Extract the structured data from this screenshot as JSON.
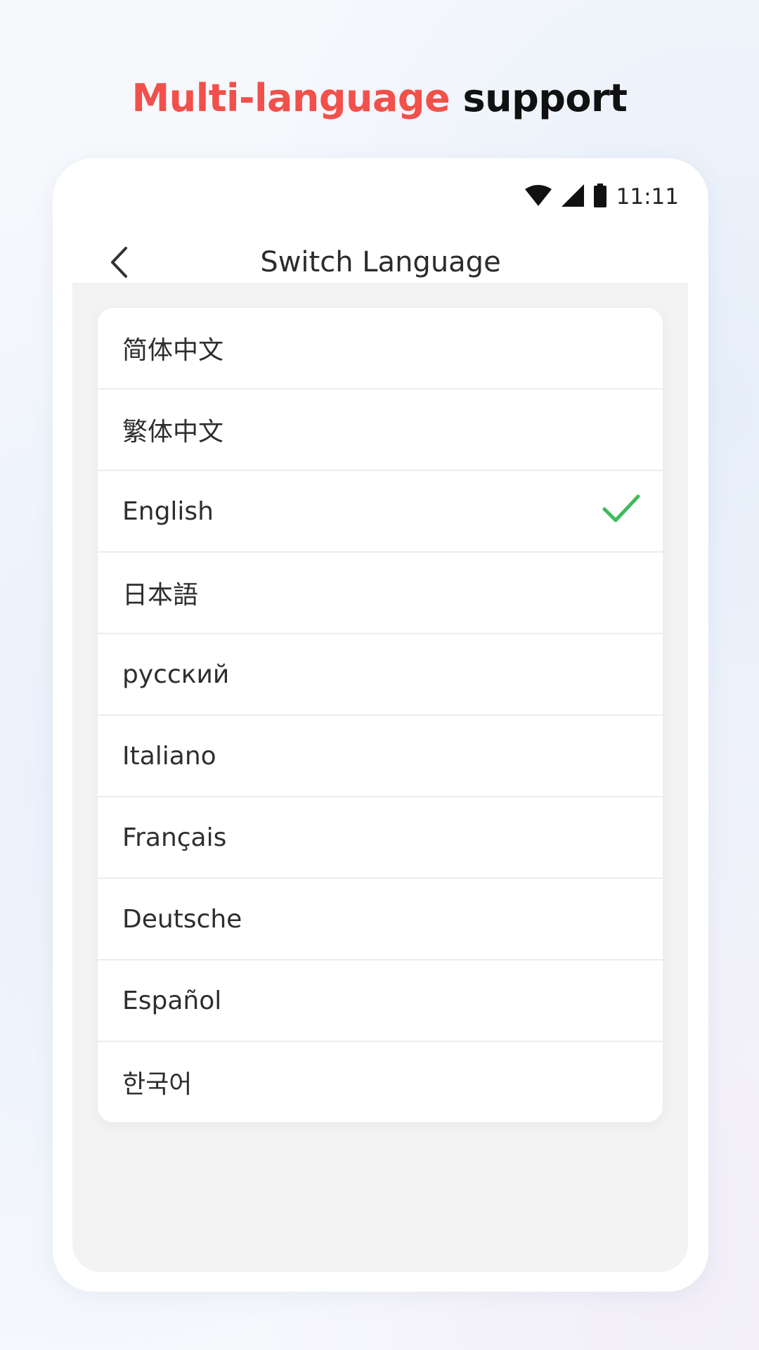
{
  "headline": {
    "accent": "Multi-language",
    "rest": "support"
  },
  "status_bar": {
    "time": "11:11",
    "icons": [
      "wifi-icon",
      "cell-signal-icon",
      "battery-icon"
    ]
  },
  "header": {
    "title": "Switch Language",
    "back_icon": "chevron-left-icon"
  },
  "languages": {
    "items": [
      {
        "label": "简体中文",
        "selected": false
      },
      {
        "label": "繁体中文",
        "selected": false
      },
      {
        "label": "English",
        "selected": true
      },
      {
        "label": "日本語",
        "selected": false
      },
      {
        "label": "русский",
        "selected": false
      },
      {
        "label": "Italiano",
        "selected": false
      },
      {
        "label": "Français",
        "selected": false
      },
      {
        "label": "Deutsche",
        "selected": false
      },
      {
        "label": "Español",
        "selected": false
      },
      {
        "label": "한국어",
        "selected": false
      }
    ]
  },
  "colors": {
    "accent": "#f2504a",
    "check": "#3dbb5c",
    "panel_bg": "#f3f3f3"
  }
}
